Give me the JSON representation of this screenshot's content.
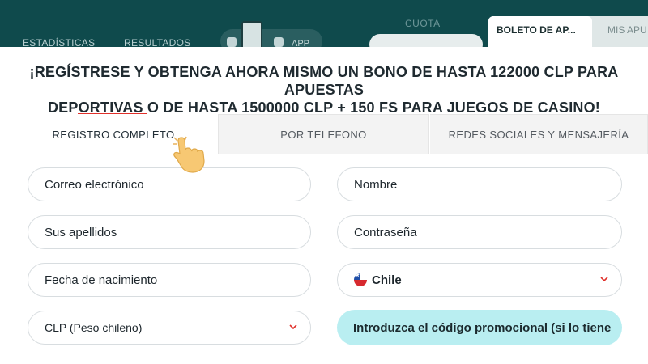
{
  "background": {
    "nav": [
      "ESTADÍSTICAS",
      "RESULTADOS"
    ],
    "app_label": "APP",
    "cuota_label": "CUOTA",
    "betslip_tabs": [
      "BOLETO DE AP...",
      "MIS APU"
    ]
  },
  "modal": {
    "headline_line1": "¡REGÍSTRESE Y OBTENGA AHORA MISMO UN BONO DE HASTA 122000 CLP PARA APUESTAS",
    "headline_line2": "DEPORTIVAS O DE HASTA 1500000 CLP + 150 FS PARA JUEGOS DE CASINO!",
    "tabs": [
      {
        "label": "REGISTRO COMPLETO",
        "active": true
      },
      {
        "label": "POR TELEFONO",
        "active": false
      },
      {
        "label": "REDES SOCIALES Y MENSAJERÍA",
        "active": false
      }
    ],
    "fields": {
      "email": {
        "placeholder": "Correo electrónico"
      },
      "name": {
        "placeholder": "Nombre"
      },
      "surname": {
        "placeholder": "Sus apellidos"
      },
      "password": {
        "placeholder": "Contraseña"
      },
      "birthdate": {
        "placeholder": "Fecha de nacimiento"
      },
      "country": {
        "value": "Chile",
        "flag_icon": "chile-flag-icon"
      },
      "currency": {
        "value": "CLP (Peso chileno)"
      },
      "promo": {
        "placeholder": "Introduzca el código promocional (si lo tiene"
      }
    },
    "colors": {
      "accent_red": "#e0302a",
      "promo_bg": "#b9eef1",
      "header_bg": "#0f4a4c"
    }
  }
}
